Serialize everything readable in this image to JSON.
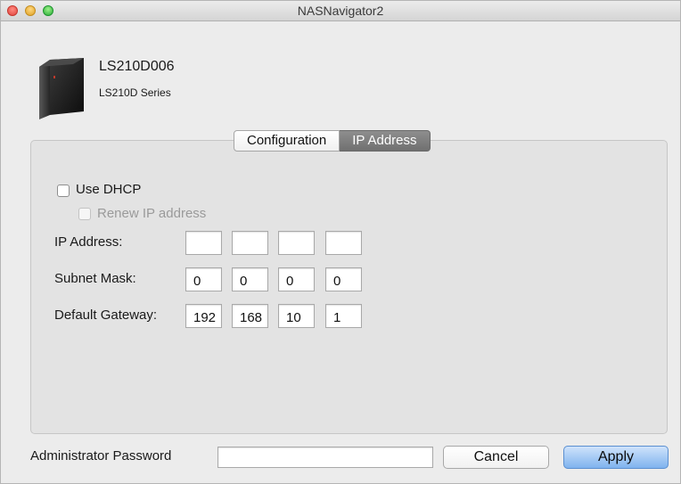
{
  "window": {
    "title": "NASNavigator2"
  },
  "device": {
    "name": "LS210D006",
    "series": "LS210D Series",
    "icon": "nas-device-icon"
  },
  "tabs": [
    {
      "label": "Configuration",
      "selected": false
    },
    {
      "label": "IP Address",
      "selected": true
    }
  ],
  "network": {
    "use_dhcp_label": "Use DHCP",
    "use_dhcp_checked": false,
    "renew_label": "Renew IP address",
    "renew_enabled": false,
    "ip_address": {
      "label": "IP Address:",
      "octets": [
        "",
        "",
        "",
        ""
      ]
    },
    "subnet_mask": {
      "label": "Subnet Mask:",
      "octets": [
        "0",
        "0",
        "0",
        "0"
      ]
    },
    "default_gateway": {
      "label": "Default Gateway:",
      "octets": [
        "192",
        "168",
        "10",
        "1"
      ]
    }
  },
  "footer": {
    "password_label": "Administrator Password",
    "password_value": "",
    "cancel_label": "Cancel",
    "apply_label": "Apply"
  },
  "colors": {
    "window_bg": "#ececec",
    "selected_tab": "#7d7d7d",
    "apply_button": "#7fb3ee"
  }
}
